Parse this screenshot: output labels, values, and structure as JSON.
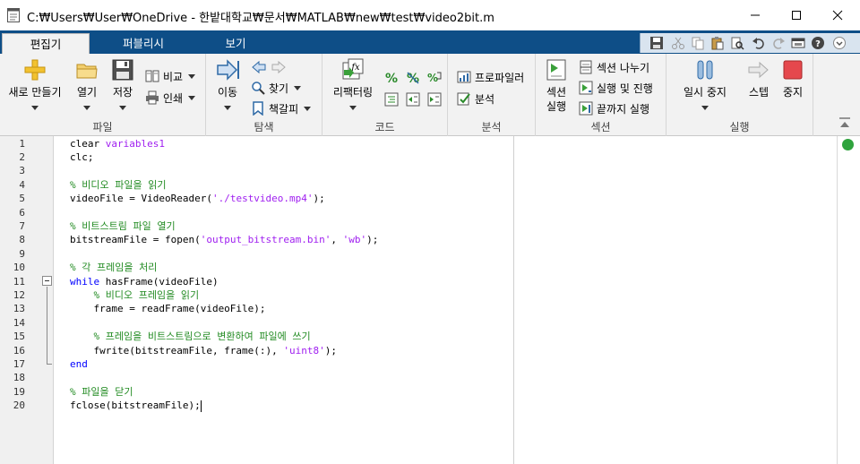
{
  "window": {
    "title": "C:₩Users₩User₩OneDrive - 한밭대학교₩문서₩MATLAB₩new₩test₩video2bit.m"
  },
  "tabs": [
    {
      "label": "편집기",
      "active": true
    },
    {
      "label": "퍼블리시",
      "active": false
    },
    {
      "label": "보기",
      "active": false
    }
  ],
  "toolstrip": {
    "file": {
      "group_label": "파일",
      "new_label": "새로 만들기",
      "open_label": "열기",
      "save_label": "저장",
      "compare_label": "비교",
      "print_label": "인쇄"
    },
    "navigate": {
      "group_label": "탐색",
      "goto_label": "이동",
      "find_label": "찾기",
      "bookmark_label": "책갈피"
    },
    "code": {
      "group_label": "코드",
      "refactor_label": "리팩터링"
    },
    "analyze": {
      "group_label": "분석",
      "profiler_label": "프로파일러",
      "analyze_label": "분석"
    },
    "section": {
      "group_label": "섹션",
      "run_section_line1": "섹션",
      "run_section_line2": "실행",
      "split_label": "섹션 나누기",
      "run_advance_label": "실행 및 진행",
      "run_to_end_label": "끝까지 실행"
    },
    "run": {
      "group_label": "실행",
      "pause_label": "일시 중지",
      "step_label": "스텝",
      "stop_label": "중지"
    }
  },
  "editor": {
    "lines": [
      {
        "n": "1",
        "text": "clear variables1"
      },
      {
        "n": "2",
        "text": "clc;"
      },
      {
        "n": "3",
        "text": ""
      },
      {
        "n": "4",
        "text": "% 비디오 파일을 읽기"
      },
      {
        "n": "5",
        "text": "videoFile = VideoReader('./testvideo.mp4');"
      },
      {
        "n": "6",
        "text": ""
      },
      {
        "n": "7",
        "text": "% 비트스트림 파일 열기"
      },
      {
        "n": "8",
        "text": "bitstreamFile = fopen('output_bitstream.bin', 'wb');"
      },
      {
        "n": "9",
        "text": ""
      },
      {
        "n": "10",
        "text": "% 각 프레임을 처리"
      },
      {
        "n": "11",
        "text": "while hasFrame(videoFile)"
      },
      {
        "n": "12",
        "text": "    % 비디오 프레임을 읽기"
      },
      {
        "n": "13",
        "text": "    frame = readFrame(videoFile);"
      },
      {
        "n": "14",
        "text": ""
      },
      {
        "n": "15",
        "text": "    % 프레임을 비트스트림으로 변환하여 파일에 쓰기"
      },
      {
        "n": "16",
        "text": "    fwrite(bitstreamFile, frame(:), 'uint8');"
      },
      {
        "n": "17",
        "text": "end"
      },
      {
        "n": "18",
        "text": ""
      },
      {
        "n": "19",
        "text": "% 파일을 닫기"
      },
      {
        "n": "20",
        "text": "fclose(bitstreamFile);"
      }
    ]
  },
  "colors": {
    "tab_strip": "#0e4e87",
    "keyword": "#0000ff",
    "string": "#a020f0",
    "comment": "#228b22",
    "ok_status": "#2fa33d"
  }
}
